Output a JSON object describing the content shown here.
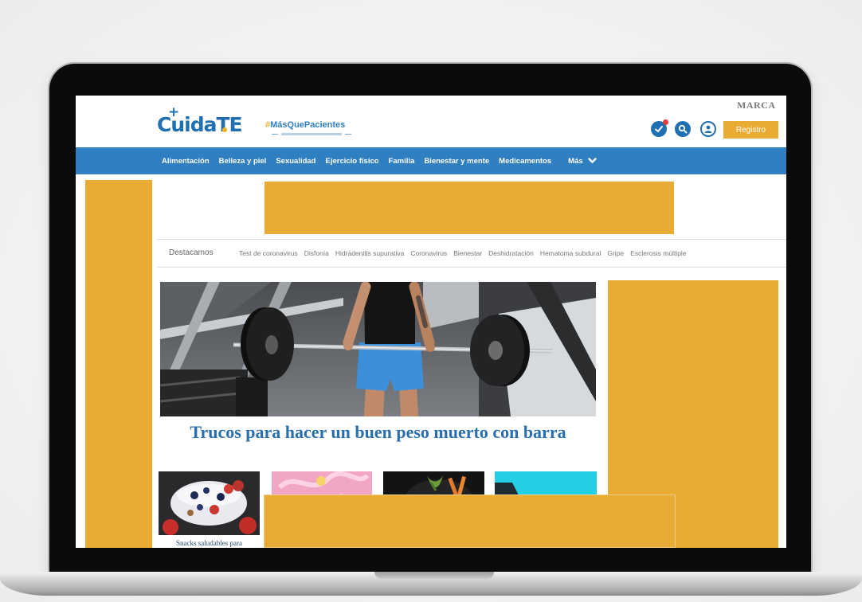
{
  "brand": {
    "marca": "MARCA",
    "logo": "CuidaTE",
    "campaign_hash": "#",
    "campaign": "MásQuePacientes"
  },
  "header": {
    "register_label": "Registro"
  },
  "nav": {
    "items": [
      "Alimentación",
      "Belleza y piel",
      "Sexualidad",
      "Ejercicio físico",
      "Familia",
      "Bienestar y mente",
      "Medicamentos"
    ],
    "more_label": "Más"
  },
  "highlights": {
    "label": "Destacamos",
    "topics": [
      "Test de coronavirus",
      "Disfonía",
      "Hidradenitis supurativa",
      "Coronavirus",
      "Bienestar",
      "Deshidratación",
      "Hematoma subdural",
      "Gripe",
      "Esclerosis múltiple"
    ]
  },
  "hero": {
    "headline": "Trucos para hacer un buen peso muerto con barra"
  },
  "thumbnails": {
    "caption_1": "Snacks saludables para"
  },
  "icons": [
    "check-icon",
    "search-icon",
    "user-icon",
    "chevron-down-icon",
    "plus-icon"
  ],
  "colors": {
    "nav_blue": "#2f7fc1",
    "brand_blue": "#1f6fb2",
    "headline_blue": "#2a6fad",
    "ad_orange": "#e9ab33",
    "register_orange": "#e9ab33"
  }
}
